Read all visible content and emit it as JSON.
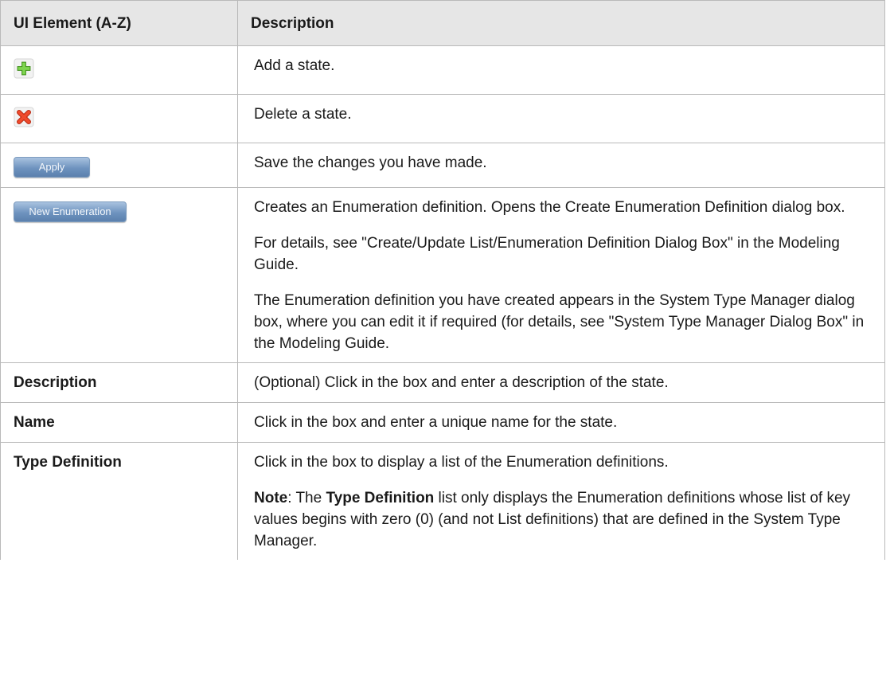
{
  "table": {
    "header": {
      "col1": "UI Element (A-Z)",
      "col2": "Description"
    },
    "rows": [
      {
        "element_icon": "add-icon",
        "description": [
          "Add a state."
        ]
      },
      {
        "element_icon": "delete-icon",
        "description": [
          "Delete a state."
        ]
      },
      {
        "element_button": "Apply",
        "description": [
          "Save the changes you have made."
        ]
      },
      {
        "element_button": "New Enumeration",
        "description": [
          "Creates an Enumeration definition. Opens the Create Enumeration Definition dialog box.",
          "For details, see \"Create/Update List/Enumeration Definition Dialog Box\" in the Modeling Guide.",
          "The Enumeration definition you have created appears in the System Type Manager dialog box, where you can edit it if required (for details, see \"System Type Manager Dialog Box\" in the Modeling Guide."
        ]
      },
      {
        "element_label": "Description",
        "description": [
          "(Optional) Click in the box and enter a description of the state."
        ]
      },
      {
        "element_label": "Name",
        "description": [
          "Click in the box and enter a unique name for the state."
        ]
      },
      {
        "element_label": "Type Definition",
        "description": [
          "Click in the box to display a list of the Enumeration definitions."
        ],
        "note": {
          "label": "Note",
          "sep": ": The ",
          "bold": "Type Definition",
          "rest": " list only displays the Enumeration definitions whose list of key values begins with zero (0) (and not List definitions) that are defined in the System Type Manager."
        }
      }
    ]
  },
  "colors": {
    "header_bg": "#e6e6e6",
    "border": "#b9b9b9",
    "add_icon": "#5cb82e",
    "delete_icon": "#e03a1e",
    "button_blue": "#6e93bf"
  }
}
